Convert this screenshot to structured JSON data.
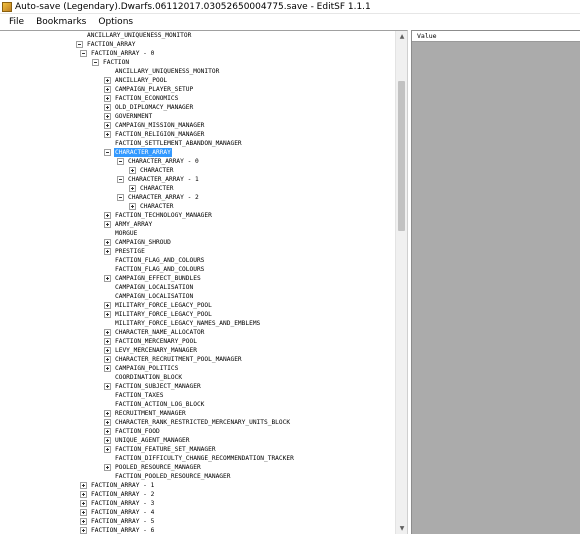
{
  "window": {
    "title": "Auto-save (Legendary).Dwarfs.06112017.03052650004775.save - EditSF 1.1.1"
  },
  "menu": [
    "File",
    "Bookmarks",
    "Options"
  ],
  "grid": {
    "column_header": "Value"
  },
  "tree": [
    {
      "label": "ANCILLARY_UNIQUENESS_MONITOR",
      "level": 0,
      "exp": "none"
    },
    {
      "label": "FACTION_ARRAY",
      "level": 0,
      "exp": "minus"
    },
    {
      "label": "FACTION_ARRAY - 0",
      "level": 1,
      "exp": "minus"
    },
    {
      "label": "FACTION",
      "level": 2,
      "exp": "minus"
    },
    {
      "label": "ANCILLARY_UNIQUENESS_MONITOR",
      "level": 3,
      "exp": "none"
    },
    {
      "label": "ANCILLARY_POOL",
      "level": 3,
      "exp": "plus"
    },
    {
      "label": "CAMPAIGN_PLAYER_SETUP",
      "level": 3,
      "exp": "plus"
    },
    {
      "label": "FACTION_ECONOMICS",
      "level": 3,
      "exp": "plus"
    },
    {
      "label": "OLD_DIPLOMACY_MANAGER",
      "level": 3,
      "exp": "plus"
    },
    {
      "label": "GOVERNMENT",
      "level": 3,
      "exp": "plus"
    },
    {
      "label": "CAMPAIGN_MISSION_MANAGER",
      "level": 3,
      "exp": "plus"
    },
    {
      "label": "FACTION_RELIGION_MANAGER",
      "level": 3,
      "exp": "plus"
    },
    {
      "label": "FACTION_SETTLEMENT_ABANDON_MANAGER",
      "level": 3,
      "exp": "none"
    },
    {
      "label": "CHARACTER_ARRAY",
      "level": 3,
      "exp": "minus",
      "selected": true
    },
    {
      "label": "CHARACTER_ARRAY - 0",
      "level": 4,
      "exp": "minus"
    },
    {
      "label": "CHARACTER",
      "level": 5,
      "exp": "plus"
    },
    {
      "label": "CHARACTER_ARRAY - 1",
      "level": 4,
      "exp": "minus"
    },
    {
      "label": "CHARACTER",
      "level": 5,
      "exp": "plus"
    },
    {
      "label": "CHARACTER_ARRAY - 2",
      "level": 4,
      "exp": "minus"
    },
    {
      "label": "CHARACTER",
      "level": 5,
      "exp": "plus"
    },
    {
      "label": "FACTION_TECHNOLOGY_MANAGER",
      "level": 3,
      "exp": "plus"
    },
    {
      "label": "ARMY_ARRAY",
      "level": 3,
      "exp": "plus"
    },
    {
      "label": "MORGUE",
      "level": 3,
      "exp": "none"
    },
    {
      "label": "CAMPAIGN_SHROUD",
      "level": 3,
      "exp": "plus"
    },
    {
      "label": "PRESTIGE",
      "level": 3,
      "exp": "plus"
    },
    {
      "label": "FACTION_FLAG_AND_COLOURS",
      "level": 3,
      "exp": "none"
    },
    {
      "label": "FACTION_FLAG_AND_COLOURS",
      "level": 3,
      "exp": "none"
    },
    {
      "label": "CAMPAIGN_EFFECT_BUNDLES",
      "level": 3,
      "exp": "plus"
    },
    {
      "label": "CAMPAIGN_LOCALISATION",
      "level": 3,
      "exp": "none"
    },
    {
      "label": "CAMPAIGN_LOCALISATION",
      "level": 3,
      "exp": "none"
    },
    {
      "label": "MILITARY_FORCE_LEGACY_POOL",
      "level": 3,
      "exp": "plus"
    },
    {
      "label": "MILITARY_FORCE_LEGACY_POOL",
      "level": 3,
      "exp": "plus"
    },
    {
      "label": "MILITARY_FORCE_LEGACY_NAMES_AND_EMBLEMS",
      "level": 3,
      "exp": "none"
    },
    {
      "label": "CHARACTER_NAME_ALLOCATOR",
      "level": 3,
      "exp": "plus"
    },
    {
      "label": "FACTION_MERCENARY_POOL",
      "level": 3,
      "exp": "plus"
    },
    {
      "label": "LEVY_MERCENARY_MANAGER",
      "level": 3,
      "exp": "plus"
    },
    {
      "label": "CHARACTER_RECRUITMENT_POOL_MANAGER",
      "level": 3,
      "exp": "plus"
    },
    {
      "label": "CAMPAIGN_POLITICS",
      "level": 3,
      "exp": "plus"
    },
    {
      "label": "COORDINATION_BLOCK",
      "level": 3,
      "exp": "none"
    },
    {
      "label": "FACTION_SUBJECT_MANAGER",
      "level": 3,
      "exp": "plus"
    },
    {
      "label": "FACTION_TAXES",
      "level": 3,
      "exp": "none"
    },
    {
      "label": "FACTION_ACTION_LOG_BLOCK",
      "level": 3,
      "exp": "none"
    },
    {
      "label": "RECRUITMENT_MANAGER",
      "level": 3,
      "exp": "plus"
    },
    {
      "label": "CHARACTER_RANK_RESTRICTED_MERCENARY_UNITS_BLOCK",
      "level": 3,
      "exp": "plus"
    },
    {
      "label": "FACTION_FOOD",
      "level": 3,
      "exp": "plus"
    },
    {
      "label": "UNIQUE_AGENT_MANAGER",
      "level": 3,
      "exp": "plus"
    },
    {
      "label": "FACTION_FEATURE_SET_MANAGER",
      "level": 3,
      "exp": "plus"
    },
    {
      "label": "FACTION_DIFFICULTY_CHANGE_RECOMMENDATION_TRACKER",
      "level": 3,
      "exp": "none"
    },
    {
      "label": "POOLED_RESOURCE_MANAGER",
      "level": 3,
      "exp": "plus"
    },
    {
      "label": "FACTION_POOLED_RESOURCE_MANAGER",
      "level": 3,
      "exp": "none"
    },
    {
      "label": "FACTION_ARRAY - 1",
      "level": 1,
      "exp": "plus"
    },
    {
      "label": "FACTION_ARRAY - 2",
      "level": 1,
      "exp": "plus"
    },
    {
      "label": "FACTION_ARRAY - 3",
      "level": 1,
      "exp": "plus"
    },
    {
      "label": "FACTION_ARRAY - 4",
      "level": 1,
      "exp": "plus"
    },
    {
      "label": "FACTION_ARRAY - 5",
      "level": 1,
      "exp": "plus"
    },
    {
      "label": "FACTION_ARRAY - 6",
      "level": 1,
      "exp": "plus"
    }
  ]
}
